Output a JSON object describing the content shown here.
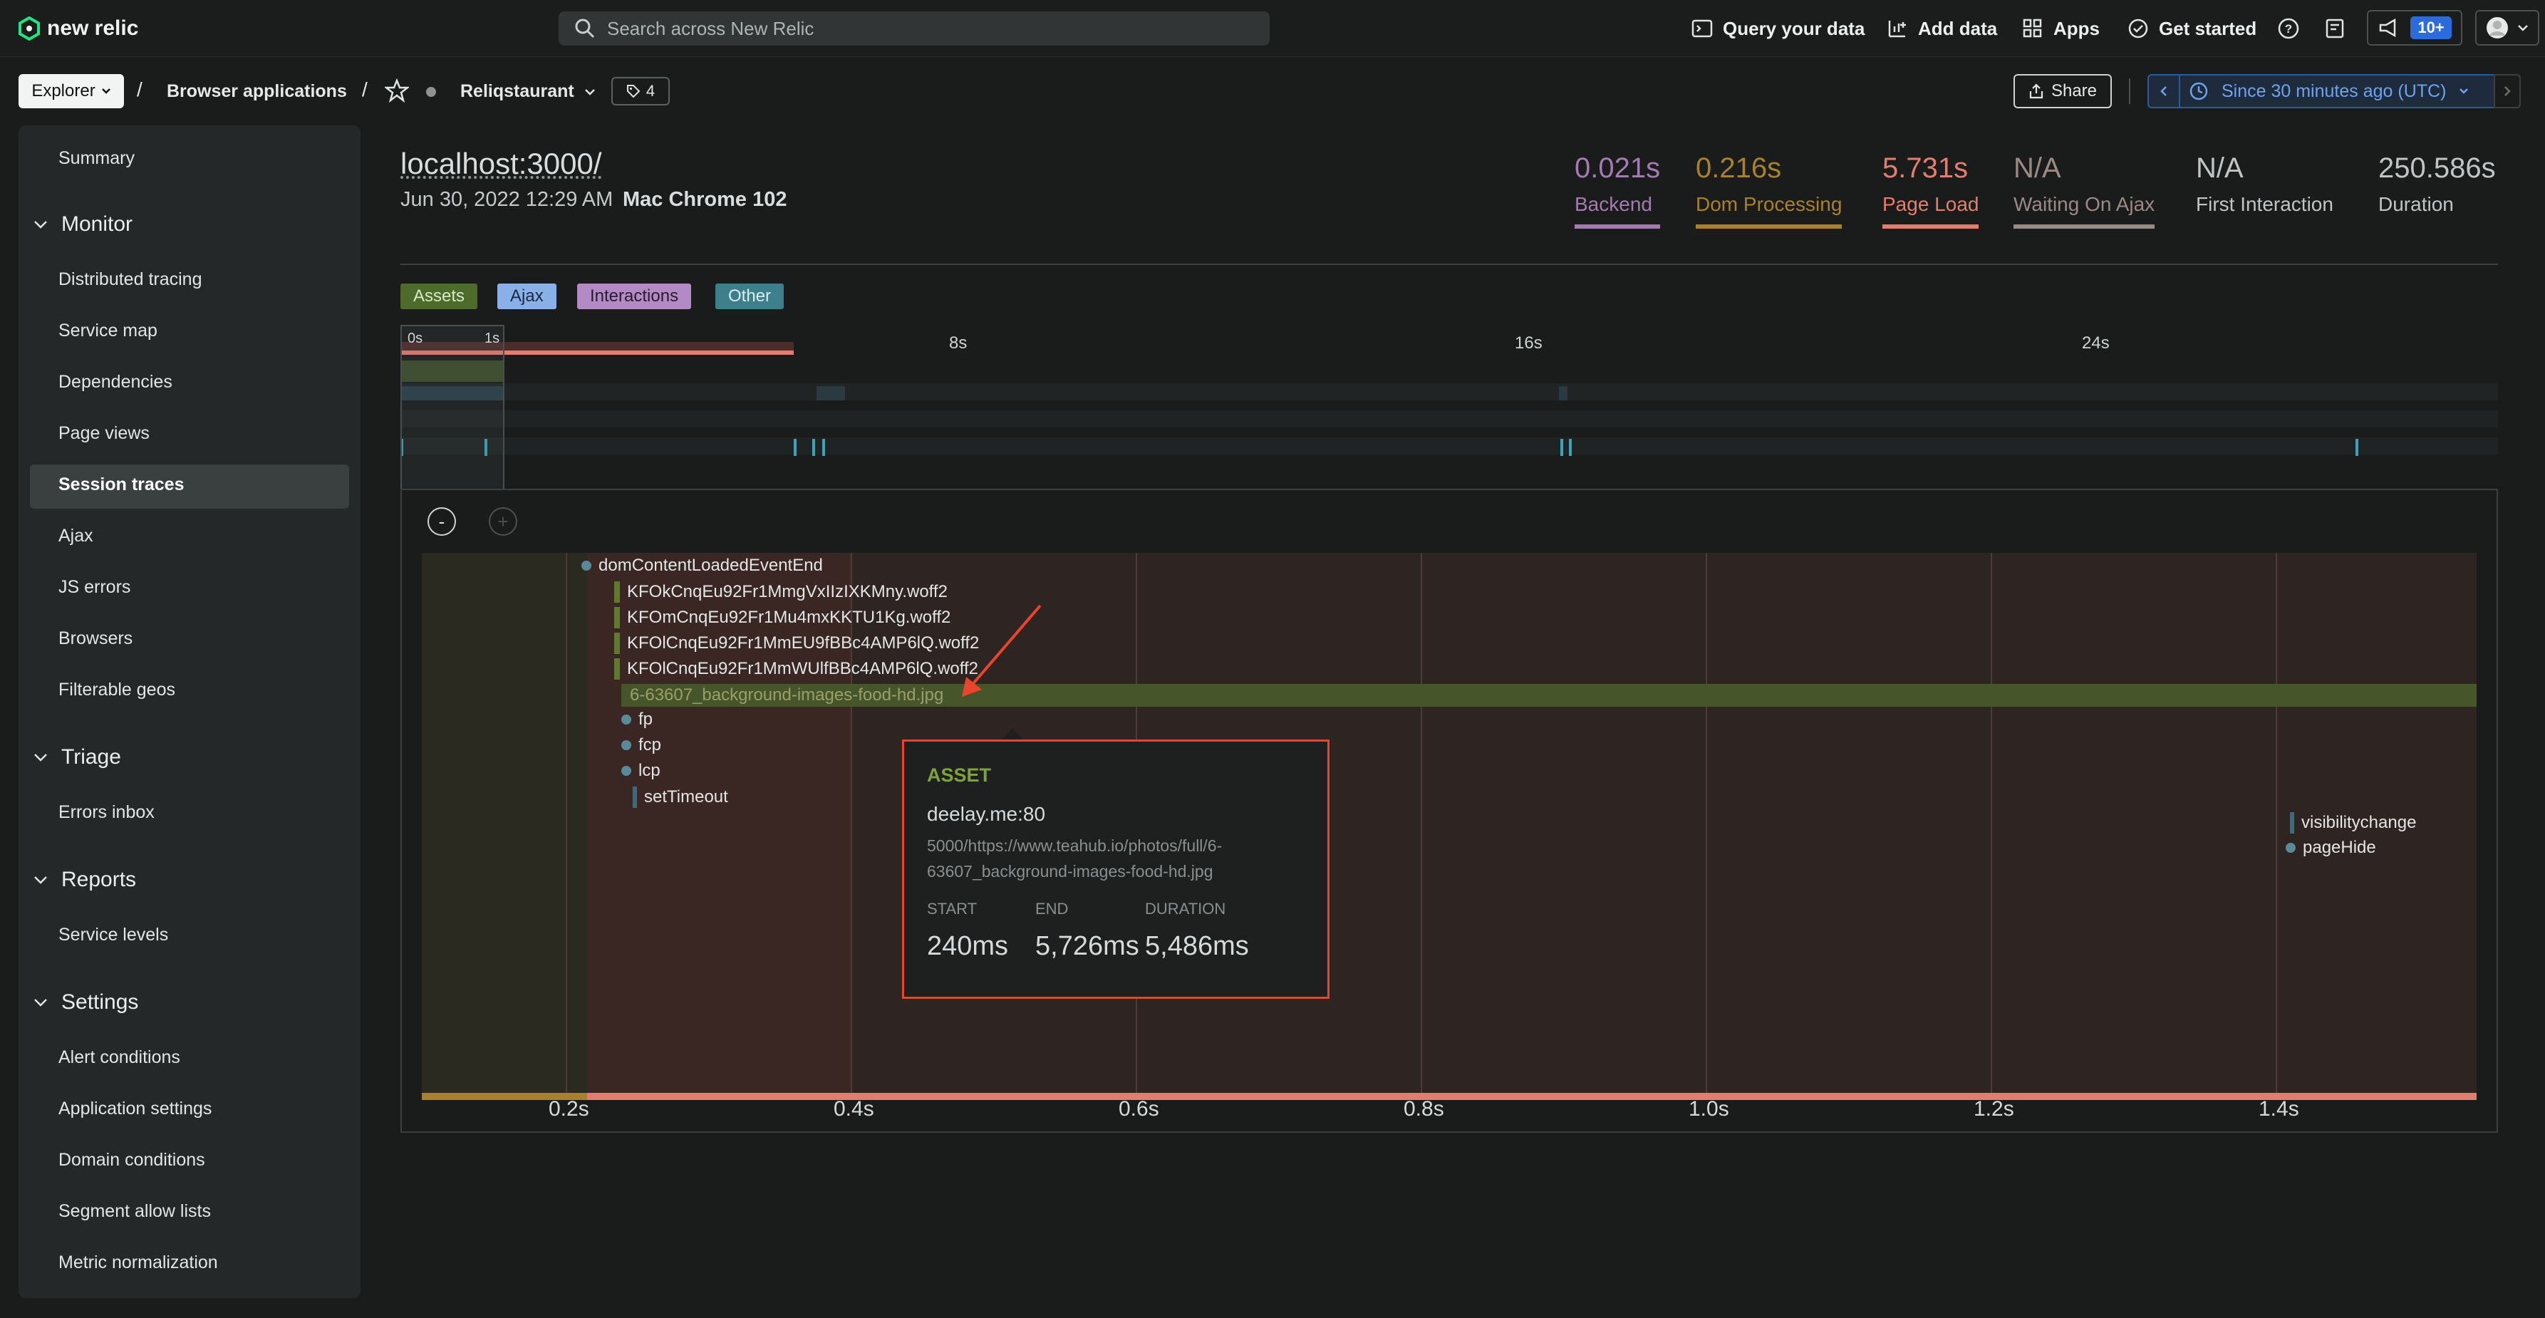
{
  "topbar": {
    "logo_text": "new relic",
    "search_placeholder": "Search across New Relic",
    "query_label": "Query your data",
    "add_data_label": "Add data",
    "apps_label": "Apps",
    "get_started_label": "Get started",
    "notifications_badge": "10+"
  },
  "breadcrumb": {
    "explorer": "Explorer",
    "sep1": "/",
    "browser_apps": "Browser applications",
    "sep2": "/",
    "app_name": "Reliqstaurant",
    "tag_count": "4",
    "share": "Share",
    "time_range": "Since 30 minutes ago (UTC)"
  },
  "sidebar": {
    "summary": "Summary",
    "monitor": "Monitor",
    "monitor_items": [
      "Distributed tracing",
      "Service map",
      "Dependencies",
      "Page views",
      "Session traces",
      "Ajax",
      "JS errors",
      "Browsers",
      "Filterable geos"
    ],
    "triage": "Triage",
    "triage_items": [
      "Errors inbox"
    ],
    "reports": "Reports",
    "reports_items": [
      "Service levels"
    ],
    "settings": "Settings",
    "settings_items": [
      "Alert conditions",
      "Application settings",
      "Domain conditions",
      "Segment allow lists",
      "Metric normalization"
    ]
  },
  "page": {
    "url": "localhost:3000/",
    "date": "Jun 30, 2022 12:29 AM",
    "browser": "Mac Chrome 102"
  },
  "metrics": [
    {
      "value": "0.021s",
      "label": "Backend",
      "color": "#a37bb0"
    },
    {
      "value": "0.216s",
      "label": "Dom Processing",
      "color": "#a9812c"
    },
    {
      "value": "5.731s",
      "label": "Page Load",
      "color": "#e57d6e"
    },
    {
      "value": "N/A",
      "label": "Waiting On Ajax",
      "color": "#9a8a86"
    },
    {
      "value": "N/A",
      "label": "First Interaction",
      "color": "#c0c4c4"
    },
    {
      "value": "250.586s",
      "label": "Duration",
      "color": "#c0c4c4"
    }
  ],
  "legend": {
    "assets": "Assets",
    "ajax": "Ajax",
    "interactions": "Interactions",
    "other": "Other"
  },
  "overview": {
    "labels": [
      "0s",
      "1s",
      "8s",
      "16s",
      "24s"
    ]
  },
  "waterfall": {
    "events": [
      "domContentLoadedEventEnd",
      "KFOkCnqEu92Fr1MmgVxIIzIXKMny.woff2",
      "KFOmCnqEu92Fr1Mu4mxKKTU1Kg.woff2",
      "KFOlCnqEu92Fr1MmEU9fBBc4AMP6lQ.woff2",
      "KFOlCnqEu92Fr1MmWUlfBBc4AMP6lQ.woff2",
      "6-63607_background-images-food-hd.jpg",
      "fp",
      "fcp",
      "lcp",
      "setTimeout"
    ],
    "right_events": [
      "visibilitychange",
      "pageHide"
    ],
    "x_axis": [
      "0.2s",
      "0.4s",
      "0.6s",
      "0.8s",
      "1.0s",
      "1.2s",
      "1.4s"
    ],
    "zoom_out": "-",
    "zoom_in": "+"
  },
  "tooltip": {
    "type": "ASSET",
    "host": "deelay.me:80",
    "path": "5000/https://www.teahub.io/photos/full/6-63607_background-images-food-hd.jpg",
    "start_label": "START",
    "end_label": "END",
    "duration_label": "DURATION",
    "start": "240ms",
    "end": "5,726ms",
    "duration": "5,486ms"
  }
}
